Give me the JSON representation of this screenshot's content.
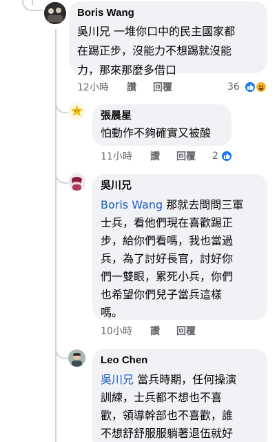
{
  "comments": [
    {
      "author": "Boris Wang",
      "lines": [
        "吳川兄 一堆你口中的民主國家都",
        "在踢正步，沒能力不想踢就沒能",
        "力，那來那麼多借口"
      ],
      "time": "12小時",
      "like": "讚",
      "reply": "回覆",
      "reaction_count": "36"
    },
    {
      "author": "張晨星",
      "lines": [
        "怕動作不夠確實又被酸"
      ],
      "time": "11小時",
      "like": "讚",
      "reply": "回覆",
      "reaction_count": "2"
    },
    {
      "author": "吳川兄",
      "mention": "Boris Wang",
      "first_line_rest": " 那就去問問三軍",
      "lines": [
        "士兵，看他們現在喜歡踢正",
        "步，給你們看嗎，我也當過",
        "兵，為了討好長官，討好你",
        "們一雙眼，累死小兵，你們",
        "也希望你們兒子當兵這樣",
        "嗎。"
      ],
      "time": "10小時",
      "like": "讚",
      "reply": "回覆"
    },
    {
      "author": "Leo Chen",
      "mention": "吳川兄",
      "first_line_rest": " 當兵時期，任何操演",
      "lines": [
        "訓練，士兵都不想也不喜",
        "歡，領導幹部也不喜歡，誰",
        "不想舒舒服服躺著退伍就好"
      ]
    }
  ],
  "colors": {
    "bubble": "#f0f2f5",
    "meta": "#65676b",
    "mention": "#1d5bbd",
    "like": "#1877f2",
    "haha": "#f7b125"
  },
  "icons": [
    "like-reaction-icon",
    "haha-reaction-icon"
  ]
}
